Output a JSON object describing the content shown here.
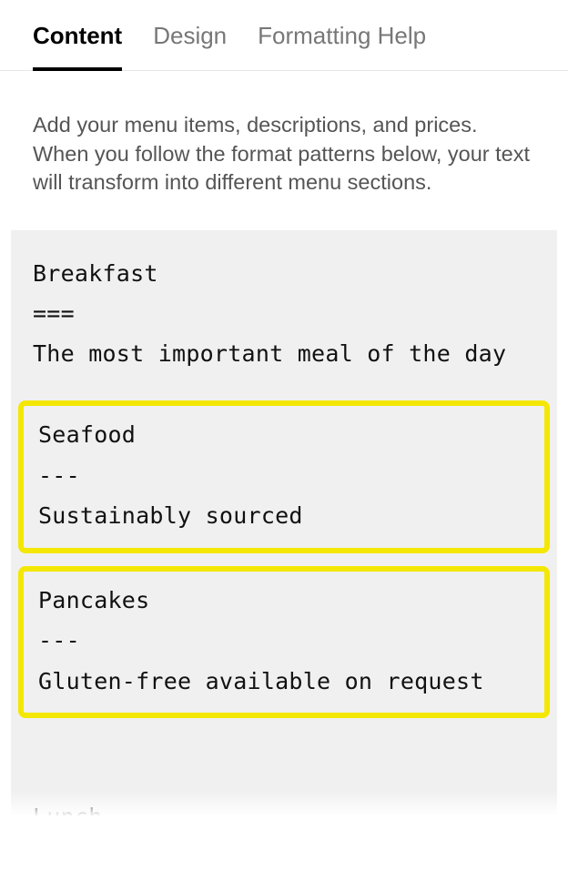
{
  "tabs": {
    "content": "Content",
    "design": "Design",
    "formatting": "Formatting Help"
  },
  "help_text": "Add your menu items, descriptions, and prices. When you follow the format patterns below, your text will transform into different menu sections.",
  "editor": {
    "block1": {
      "title": "Breakfast",
      "separator": "===",
      "desc": "The most important meal of the day"
    },
    "highlight1": {
      "title": "Seafood",
      "separator": "---",
      "desc": "Sustainably sourced"
    },
    "highlight2": {
      "title": "Pancakes",
      "separator": "---",
      "desc": "Gluten-free available on request"
    },
    "cutoff": "Lunch"
  }
}
